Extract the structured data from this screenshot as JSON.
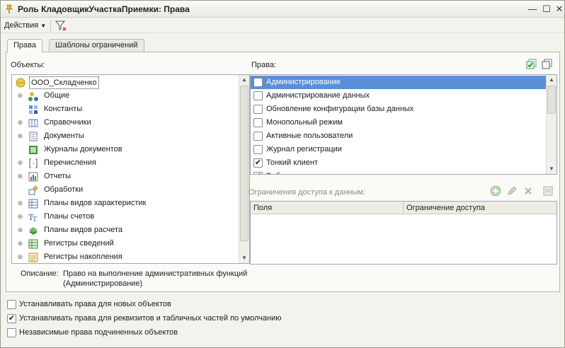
{
  "window": {
    "title": "Роль КладовщикУчасткаПриемки: Права",
    "minimize": "—",
    "maximize": "☐",
    "close": "✕"
  },
  "toolbar": {
    "actions_label": "Действия"
  },
  "tabs": [
    {
      "label": "Права",
      "active": true
    },
    {
      "label": "Шаблоны ограничений",
      "active": false
    }
  ],
  "objects": {
    "label": "Объекты:",
    "root": "ООО_Складченко",
    "items": [
      {
        "label": "Общие",
        "icon": "common-icon",
        "expandable": true
      },
      {
        "label": "Константы",
        "icon": "constants-icon",
        "expandable": false
      },
      {
        "label": "Справочники",
        "icon": "catalogs-icon",
        "expandable": true
      },
      {
        "label": "Документы",
        "icon": "documents-icon",
        "expandable": true
      },
      {
        "label": "Журналы документов",
        "icon": "journals-icon",
        "expandable": false
      },
      {
        "label": "Перечисления",
        "icon": "enums-icon",
        "expandable": true
      },
      {
        "label": "Отчеты",
        "icon": "reports-icon",
        "expandable": true
      },
      {
        "label": "Обработки",
        "icon": "dataprocessors-icon",
        "expandable": false
      },
      {
        "label": "Планы видов характеристик",
        "icon": "chart-types-icon",
        "expandable": true
      },
      {
        "label": "Планы счетов",
        "icon": "chart-of-accounts-icon",
        "expandable": true
      },
      {
        "label": "Планы видов расчета",
        "icon": "calc-types-icon",
        "expandable": true
      },
      {
        "label": "Регистры сведений",
        "icon": "info-registers-icon",
        "expandable": true
      },
      {
        "label": "Регистры накопления",
        "icon": "accum-registers-icon",
        "expandable": true
      }
    ]
  },
  "description": {
    "label": "Описание:",
    "text_line1": "Право на выполнение административных функций",
    "text_line2": "(Администрирование)"
  },
  "rights": {
    "label": "Права:",
    "items": [
      {
        "label": "Администрирование",
        "checked": false,
        "selected": true
      },
      {
        "label": "Администрирование данных",
        "checked": false,
        "selected": false
      },
      {
        "label": "Обновление конфигурации базы данных",
        "checked": false,
        "selected": false
      },
      {
        "label": "Монопольный режим",
        "checked": false,
        "selected": false
      },
      {
        "label": "Активные пользователи",
        "checked": false,
        "selected": false
      },
      {
        "label": "Журнал регистрации",
        "checked": false,
        "selected": false
      },
      {
        "label": "Тонкий клиент",
        "checked": true,
        "selected": false
      },
      {
        "label": "Веб-клиент",
        "checked": true,
        "selected": false
      }
    ]
  },
  "restrictions": {
    "label": "Ограничения доступа к данным:",
    "columns": [
      "Поля",
      "Ограничение доступа"
    ]
  },
  "options": [
    {
      "label": "Устанавливать права для новых объектов",
      "checked": false
    },
    {
      "label": "Устанавливать права для реквизитов и табличных частей по умолчанию",
      "checked": true
    },
    {
      "label": "Независимые права подчиненных объектов",
      "checked": false
    }
  ],
  "colors": {
    "selection": "#5a8fd6",
    "accent_green": "#3a9a3a"
  }
}
